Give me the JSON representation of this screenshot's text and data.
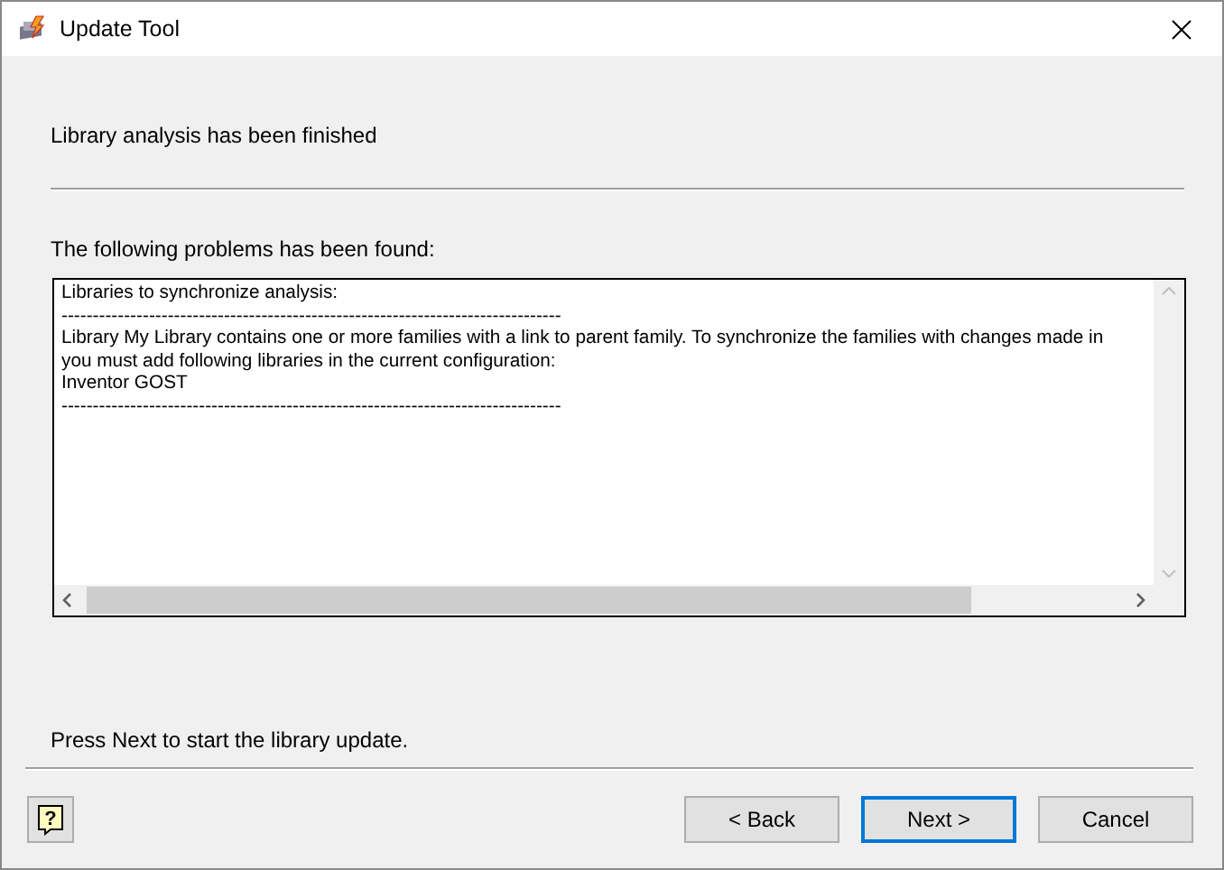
{
  "window": {
    "title": "Update Tool"
  },
  "status": "Library analysis has been finished",
  "problems_label": "The following problems has been found:",
  "report": {
    "lines": [
      "Libraries to synchronize analysis:",
      "--------------------------------------------------------------------------------",
      "Library My Library contains one or more families with a link to parent family. To synchronize the families with changes made in",
      "you must add following libraries in the current configuration:",
      "Inventor GOST",
      "--------------------------------------------------------------------------------"
    ]
  },
  "hint": "Press Next to start the library update.",
  "help": {
    "glyph": "?"
  },
  "buttons": [
    {
      "label": "< Back",
      "focused": false
    },
    {
      "label": "Next >",
      "focused": true
    },
    {
      "label": "Cancel",
      "focused": false
    }
  ]
}
